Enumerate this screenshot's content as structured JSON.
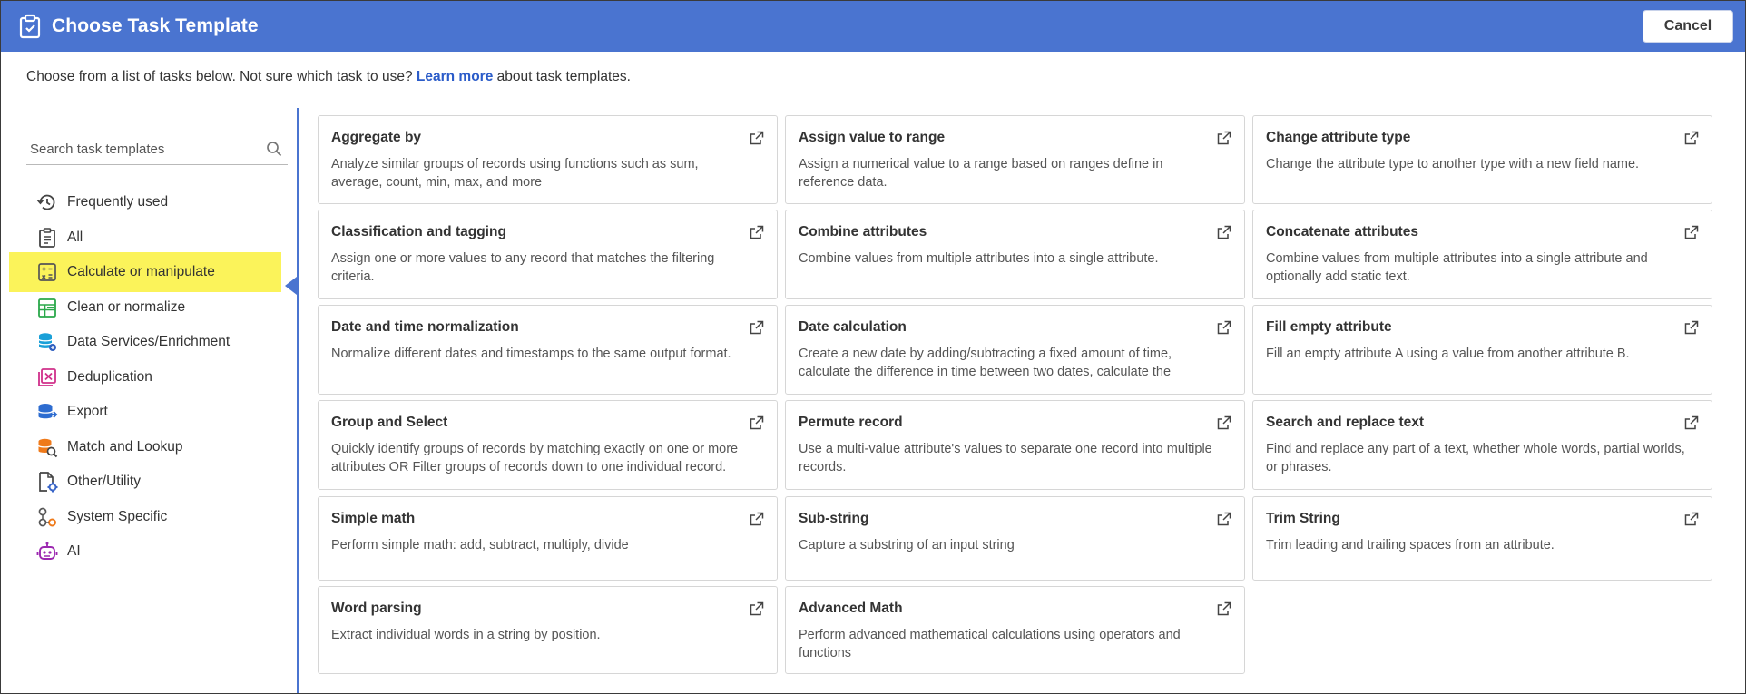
{
  "header": {
    "title": "Choose Task Template",
    "cancel_label": "Cancel",
    "background_color": "#4a74d0"
  },
  "intro": {
    "before": "Choose from a list of tasks below. Not sure which task to use? ",
    "link": "Learn more",
    "after": " about task templates."
  },
  "search": {
    "placeholder": "Search task templates",
    "value": ""
  },
  "categories": [
    {
      "label": "Frequently used",
      "icon": "history-icon"
    },
    {
      "label": "All",
      "icon": "clipboard-icon"
    },
    {
      "label": "Calculate or manipulate",
      "icon": "calculator-icon",
      "selected": true
    },
    {
      "label": "Clean or normalize",
      "icon": "spreadsheet-icon"
    },
    {
      "label": "Data Services/Enrichment",
      "icon": "database-icon"
    },
    {
      "label": "Deduplication",
      "icon": "deduplicate-icon"
    },
    {
      "label": "Export",
      "icon": "export-icon"
    },
    {
      "label": "Match and Lookup",
      "icon": "match-lookup-icon"
    },
    {
      "label": "Other/Utility",
      "icon": "utility-icon"
    },
    {
      "label": "System Specific",
      "icon": "system-icon"
    },
    {
      "label": "AI",
      "icon": "robot-icon"
    }
  ],
  "templates": [
    {
      "title": "Aggregate by",
      "description": "Analyze similar groups of records using functions such as sum, average, count, min, max, and more"
    },
    {
      "title": "Assign value to range",
      "description": "Assign a numerical value to a range based on ranges define in reference data."
    },
    {
      "title": "Change attribute type",
      "description": "Change the attribute type to another type with a new field name."
    },
    {
      "title": "Classification and tagging",
      "description": "Assign one or more values to any record that matches the filtering criteria."
    },
    {
      "title": "Combine attributes",
      "description": "Combine values from multiple attributes into a single attribute."
    },
    {
      "title": "Concatenate attributes",
      "description": "Combine values from multiple attributes into a single attribute and optionally add static text."
    },
    {
      "title": "Date and time normalization",
      "description": "Normalize different dates and timestamps to the same output format."
    },
    {
      "title": "Date calculation",
      "description": "Create a new date by adding/subtracting a fixed amount of time, calculate the difference in time between two dates, calculate the amount of time..."
    },
    {
      "title": "Fill empty attribute",
      "description": "Fill an empty attribute A using a value from another attribute B."
    },
    {
      "title": "Group and Select",
      "description": "Quickly identify groups of records by matching exactly on one or more attributes OR Filter groups of records down to one individual record."
    },
    {
      "title": "Permute record",
      "description": "Use a multi-value attribute's values to separate one record into multiple records."
    },
    {
      "title": "Search and replace text",
      "description": "Find and replace any part of a text, whether whole words, partial worlds, or phrases."
    },
    {
      "title": "Simple math",
      "description": "Perform simple math: add, subtract, multiply, divide"
    },
    {
      "title": "Sub-string",
      "description": "Capture a substring of an input string"
    },
    {
      "title": "Trim String",
      "description": "Trim leading and trailing spaces from an attribute."
    },
    {
      "title": "Word parsing",
      "description": "Extract individual words in a string by position."
    },
    {
      "title": "Advanced Math",
      "description": "Perform advanced mathematical calculations using operators and functions"
    }
  ]
}
